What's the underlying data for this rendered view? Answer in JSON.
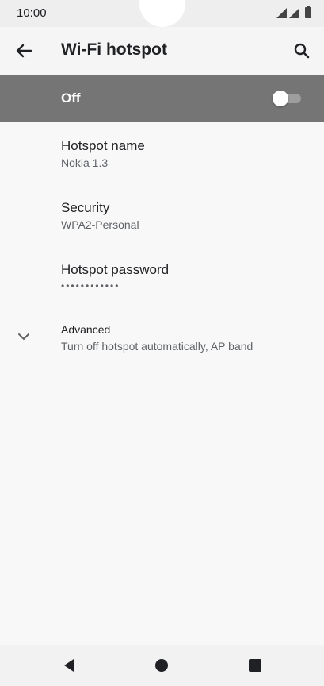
{
  "status_bar": {
    "time": "10:00"
  },
  "toolbar": {
    "title": "Wi-Fi hotspot"
  },
  "master_switch": {
    "label": "Off",
    "checked": false
  },
  "preferences": [
    {
      "title": "Hotspot name",
      "summary": "Nokia 1.3"
    },
    {
      "title": "Security",
      "summary": "WPA2-Personal"
    },
    {
      "title": "Hotspot password",
      "summary": "••••••••••••"
    }
  ],
  "advanced": {
    "title": "Advanced",
    "summary": "Turn off hotspot automatically, AP band"
  },
  "icons": {
    "back": "arrow-back-icon",
    "search": "search-icon",
    "expand": "chevron-down-icon",
    "nav_back": "triangle-back-icon",
    "nav_home": "circle-home-icon",
    "nav_recents": "square-recents-icon"
  },
  "colors": {
    "switch_bar": "#757575",
    "background": "#f8f8f8"
  }
}
